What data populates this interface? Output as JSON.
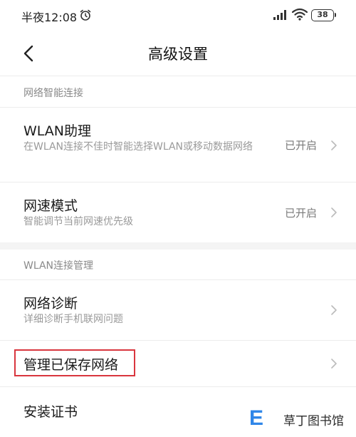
{
  "status_bar": {
    "time": "半夜12:08",
    "battery": "38"
  },
  "header": {
    "title": "高级设置"
  },
  "sections": [
    {
      "header": "网络智能连接",
      "items": [
        {
          "title": "WLAN助理",
          "description": "在WLAN连接不佳时智能选择WLAN或移动数据网络",
          "value": "已开启"
        },
        {
          "title": "网速模式",
          "description": "智能调节当前网速优先级",
          "value": "已开启"
        }
      ]
    },
    {
      "header": "WLAN连接管理",
      "items": [
        {
          "title": "网络诊断",
          "description": "详细诊断手机联网问题",
          "value": ""
        },
        {
          "title": "管理已保存网络",
          "description": "",
          "value": ""
        },
        {
          "title": "安装证书",
          "description": "",
          "value": ""
        }
      ]
    }
  ],
  "watermark": {
    "text": "草丁图书馆"
  },
  "colors": {
    "highlight": "#d9363e",
    "watermark_accent": "#2f86e8"
  }
}
